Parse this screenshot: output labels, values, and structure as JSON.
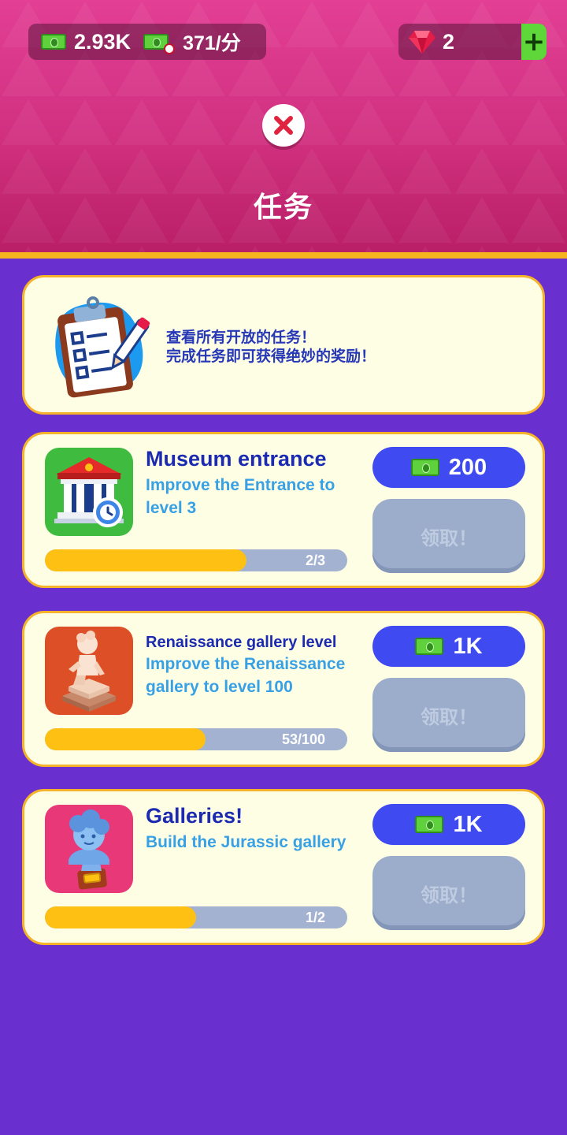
{
  "currency": {
    "cash": "2.93K",
    "rate": "371/分",
    "gems": "2",
    "gem_add": "+"
  },
  "header": {
    "title": "任务"
  },
  "intro": {
    "line1": "查看所有开放的任务！",
    "line2": "完成任务即可获得绝妙的奖励！"
  },
  "missions": [
    {
      "title": "Museum entrance",
      "description": "Improve the Entrance to level 3",
      "progress_text": "2/3",
      "progress": 0.667,
      "reward": "200",
      "claim_label": "领取！",
      "icon": "museum-building-icon"
    },
    {
      "title": "Renaissance gallery level",
      "description": "Improve the Renaissance gallery to level 100",
      "progress_text": "53/100",
      "progress": 0.53,
      "reward": "1K",
      "claim_label": "领取！",
      "icon": "statue-icon"
    },
    {
      "title": "Galleries!",
      "description": "Build the Jurassic gallery",
      "progress_text": "1/2",
      "progress": 0.5,
      "reward": "1K",
      "claim_label": "领取！",
      "icon": "bust-icon"
    }
  ],
  "colors": {
    "background": "#6a2fcf",
    "header": "#d1307f",
    "card": "#fefee4",
    "card_border": "#f4b32b",
    "reward_button": "#3f4bf0",
    "claim_disabled": "#9caccb",
    "progress_fill": "#fdc013",
    "progress_track": "#a3b2d1"
  }
}
